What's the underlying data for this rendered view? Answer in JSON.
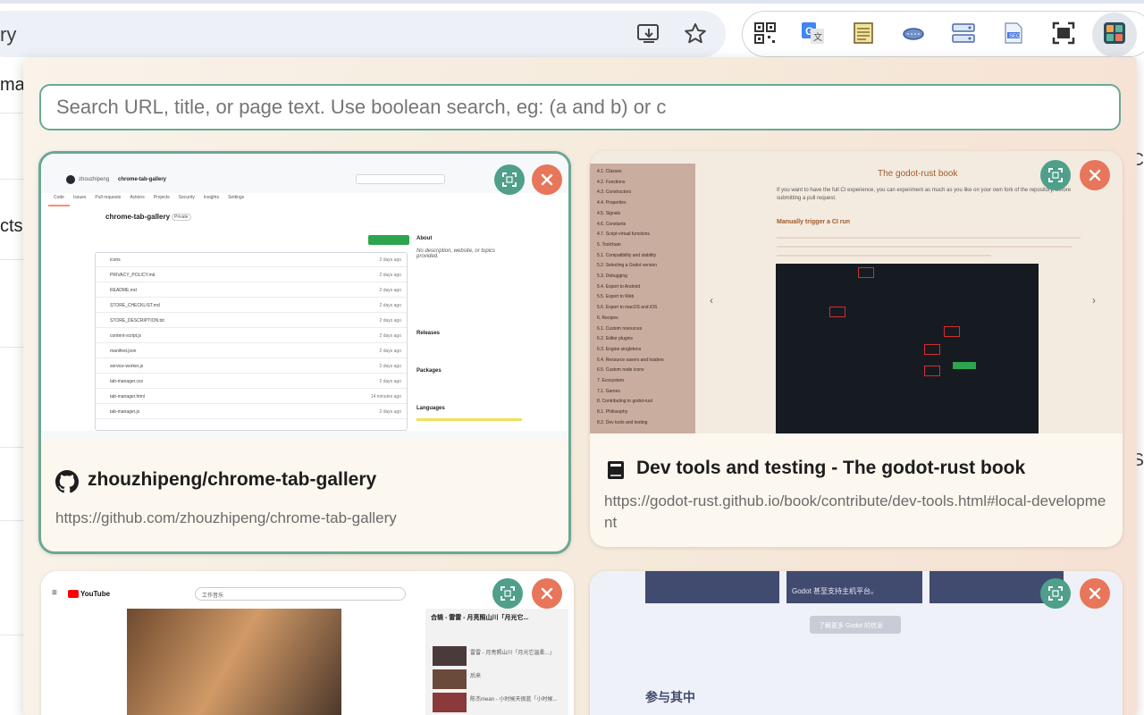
{
  "browser": {
    "omnibox_text": "ry",
    "icons": [
      "install-icon",
      "star-icon"
    ],
    "extensions": [
      "qr-code-icon",
      "translate-icon",
      "notes-icon",
      "cloud-icon",
      "server-icon",
      "seo-icon",
      "screenshot-icon",
      "tab-gallery-icon"
    ]
  },
  "background_fragments": {
    "left": [
      "ma",
      "cts"
    ],
    "right": [
      "C",
      "S"
    ]
  },
  "popup": {
    "search_placeholder": "Search URL, title, or page text. Use boolean search, eg: (a and b) or c",
    "accent_color": "#6aa895",
    "focus_color": "#4f9f8b",
    "close_color": "#e8765a",
    "cards": [
      {
        "title": "zhouzhipeng/chrome-tab-gallery",
        "url": "https://github.com/zhouzhipeng/chrome-tab-gallery",
        "favicon": "github-icon",
        "selected": true,
        "thumb": {
          "repo_owner": "zhouzhipeng",
          "repo_name": "chrome-tab-gallery",
          "repo_heading": "chrome-tab-gallery",
          "visibility": "Private",
          "tabs": [
            "Code",
            "Issues",
            "Pull requests",
            "Actions",
            "Projects",
            "Security",
            "Insights",
            "Settings"
          ],
          "files": [
            "icons",
            "PRIVACY_POLICY.md",
            "README.md",
            "STORE_CHECKLIST.md",
            "STORE_DESCRIPTION.txt",
            "content-script.js",
            "manifest.json",
            "service-worker.js",
            "tab-manager.css",
            "tab-manager.html",
            "tab-manager.js"
          ],
          "file_ages": [
            "2 days ago",
            "2 days ago",
            "2 days ago",
            "2 days ago",
            "2 days ago",
            "2 days ago",
            "2 days ago",
            "2 days ago",
            "2 days ago",
            "14 minutes ago",
            "2 days ago"
          ],
          "about_heading": "About",
          "about_text": "No description, website, or topics provided.",
          "releases_heading": "Releases",
          "packages_heading": "Packages",
          "languages_heading": "Languages"
        }
      },
      {
        "title": "Dev tools and testing - The godot-rust book",
        "url": "https://godot-rust.github.io/book/contribute/dev-tools.html#local-development",
        "favicon": "book-icon",
        "selected": false,
        "thumb": {
          "book_title": "The godot-rust book",
          "section_heading": "Manually trigger a CI run",
          "intro": "If you want to have the full CI experience, you can experiment as much as you like on your own fork of the repository, before submitting a pull request.",
          "toc": [
            "4.1. Classes",
            "4.2. Functions",
            "4.3. Constructors",
            "4.4. Properties",
            "4.5. Signals",
            "4.6. Constants",
            "4.7. Script-virtual functions",
            "5. Toolchain",
            "5.1. Compatibility and stability",
            "5.2. Selecting a Godot version",
            "5.3. Debugging",
            "5.4. Export to Android",
            "5.5. Export to Web",
            "5.6. Export to macOS and iOS",
            "6. Recipes",
            "6.1. Custom resources",
            "6.2. Editor plugins",
            "6.3. Engine singletons",
            "6.4. Resource savers and loaders",
            "6.5. Custom node icons",
            "7. Ecosystem",
            "7.1. Games",
            "8. Contributing to godot-rust",
            "8.1. Philosophy",
            "8.2. Dev tools and testing"
          ]
        }
      },
      {
        "title": "",
        "url": "",
        "favicon": "youtube-icon",
        "selected": false,
        "thumb": {
          "brand": "YouTube",
          "search": "工作音乐",
          "playlist_title": "合辑 - 雷雷 - 月亮照山川「月光它...",
          "items": [
            "雷雷 - 月亮照山川「月光它温柔...」",
            "后来",
            "陈杰mean - 小时候天很蓝「小时候..."
          ]
        }
      },
      {
        "title": "",
        "url": "",
        "favicon": "godot-icon",
        "selected": false,
        "thumb": {
          "box_text": "Godot 甚至支持主机平台。",
          "button_text": "了解更多 Godot 的信息",
          "heading": "参与其中"
        }
      }
    ]
  }
}
